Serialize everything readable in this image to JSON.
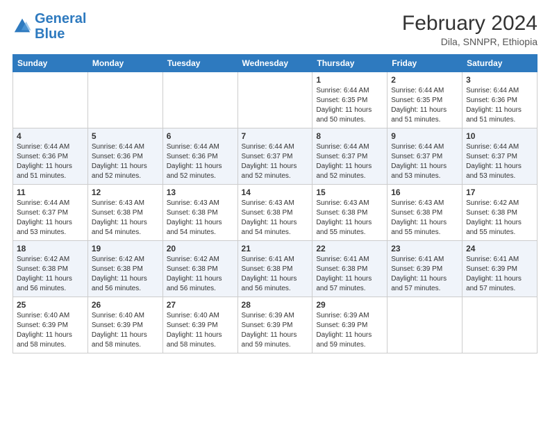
{
  "logo": {
    "line1": "General",
    "line2": "Blue"
  },
  "header": {
    "month_year": "February 2024",
    "location": "Dila, SNNPR, Ethiopia"
  },
  "weekdays": [
    "Sunday",
    "Monday",
    "Tuesday",
    "Wednesday",
    "Thursday",
    "Friday",
    "Saturday"
  ],
  "weeks": [
    [
      {
        "day": "",
        "info": ""
      },
      {
        "day": "",
        "info": ""
      },
      {
        "day": "",
        "info": ""
      },
      {
        "day": "",
        "info": ""
      },
      {
        "day": "1",
        "info": "Sunrise: 6:44 AM\nSunset: 6:35 PM\nDaylight: 11 hours\nand 50 minutes."
      },
      {
        "day": "2",
        "info": "Sunrise: 6:44 AM\nSunset: 6:35 PM\nDaylight: 11 hours\nand 51 minutes."
      },
      {
        "day": "3",
        "info": "Sunrise: 6:44 AM\nSunset: 6:36 PM\nDaylight: 11 hours\nand 51 minutes."
      }
    ],
    [
      {
        "day": "4",
        "info": "Sunrise: 6:44 AM\nSunset: 6:36 PM\nDaylight: 11 hours\nand 51 minutes."
      },
      {
        "day": "5",
        "info": "Sunrise: 6:44 AM\nSunset: 6:36 PM\nDaylight: 11 hours\nand 52 minutes."
      },
      {
        "day": "6",
        "info": "Sunrise: 6:44 AM\nSunset: 6:36 PM\nDaylight: 11 hours\nand 52 minutes."
      },
      {
        "day": "7",
        "info": "Sunrise: 6:44 AM\nSunset: 6:37 PM\nDaylight: 11 hours\nand 52 minutes."
      },
      {
        "day": "8",
        "info": "Sunrise: 6:44 AM\nSunset: 6:37 PM\nDaylight: 11 hours\nand 52 minutes."
      },
      {
        "day": "9",
        "info": "Sunrise: 6:44 AM\nSunset: 6:37 PM\nDaylight: 11 hours\nand 53 minutes."
      },
      {
        "day": "10",
        "info": "Sunrise: 6:44 AM\nSunset: 6:37 PM\nDaylight: 11 hours\nand 53 minutes."
      }
    ],
    [
      {
        "day": "11",
        "info": "Sunrise: 6:44 AM\nSunset: 6:37 PM\nDaylight: 11 hours\nand 53 minutes."
      },
      {
        "day": "12",
        "info": "Sunrise: 6:43 AM\nSunset: 6:38 PM\nDaylight: 11 hours\nand 54 minutes."
      },
      {
        "day": "13",
        "info": "Sunrise: 6:43 AM\nSunset: 6:38 PM\nDaylight: 11 hours\nand 54 minutes."
      },
      {
        "day": "14",
        "info": "Sunrise: 6:43 AM\nSunset: 6:38 PM\nDaylight: 11 hours\nand 54 minutes."
      },
      {
        "day": "15",
        "info": "Sunrise: 6:43 AM\nSunset: 6:38 PM\nDaylight: 11 hours\nand 55 minutes."
      },
      {
        "day": "16",
        "info": "Sunrise: 6:43 AM\nSunset: 6:38 PM\nDaylight: 11 hours\nand 55 minutes."
      },
      {
        "day": "17",
        "info": "Sunrise: 6:42 AM\nSunset: 6:38 PM\nDaylight: 11 hours\nand 55 minutes."
      }
    ],
    [
      {
        "day": "18",
        "info": "Sunrise: 6:42 AM\nSunset: 6:38 PM\nDaylight: 11 hours\nand 56 minutes."
      },
      {
        "day": "19",
        "info": "Sunrise: 6:42 AM\nSunset: 6:38 PM\nDaylight: 11 hours\nand 56 minutes."
      },
      {
        "day": "20",
        "info": "Sunrise: 6:42 AM\nSunset: 6:38 PM\nDaylight: 11 hours\nand 56 minutes."
      },
      {
        "day": "21",
        "info": "Sunrise: 6:41 AM\nSunset: 6:38 PM\nDaylight: 11 hours\nand 56 minutes."
      },
      {
        "day": "22",
        "info": "Sunrise: 6:41 AM\nSunset: 6:38 PM\nDaylight: 11 hours\nand 57 minutes."
      },
      {
        "day": "23",
        "info": "Sunrise: 6:41 AM\nSunset: 6:39 PM\nDaylight: 11 hours\nand 57 minutes."
      },
      {
        "day": "24",
        "info": "Sunrise: 6:41 AM\nSunset: 6:39 PM\nDaylight: 11 hours\nand 57 minutes."
      }
    ],
    [
      {
        "day": "25",
        "info": "Sunrise: 6:40 AM\nSunset: 6:39 PM\nDaylight: 11 hours\nand 58 minutes."
      },
      {
        "day": "26",
        "info": "Sunrise: 6:40 AM\nSunset: 6:39 PM\nDaylight: 11 hours\nand 58 minutes."
      },
      {
        "day": "27",
        "info": "Sunrise: 6:40 AM\nSunset: 6:39 PM\nDaylight: 11 hours\nand 58 minutes."
      },
      {
        "day": "28",
        "info": "Sunrise: 6:39 AM\nSunset: 6:39 PM\nDaylight: 11 hours\nand 59 minutes."
      },
      {
        "day": "29",
        "info": "Sunrise: 6:39 AM\nSunset: 6:39 PM\nDaylight: 11 hours\nand 59 minutes."
      },
      {
        "day": "",
        "info": ""
      },
      {
        "day": "",
        "info": ""
      }
    ]
  ]
}
